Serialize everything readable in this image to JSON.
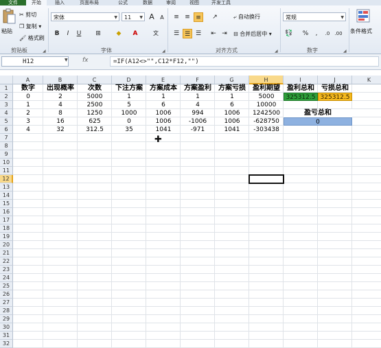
{
  "ribbon": {
    "tabs": [
      "文件",
      "开始",
      "插入",
      "页面布局",
      "公式",
      "数据",
      "审阅",
      "视图",
      "开发工具"
    ],
    "clipboard": {
      "paste": "粘贴",
      "cut": "剪切",
      "copy": "复制",
      "format_painter": "格式刷",
      "group": "剪贴板"
    },
    "font": {
      "name": "宋体",
      "size": "11",
      "bold": "B",
      "italic": "I",
      "underline": "U",
      "grow": "A",
      "shrink": "A",
      "group": "字体"
    },
    "alignment": {
      "wrap": "自动换行",
      "merge": "合并后居中",
      "group": "对齐方式"
    },
    "number": {
      "format": "常规",
      "percent": "%",
      "comma": ",",
      "group": "数字"
    },
    "styles": {
      "conditional": "条件格式"
    }
  },
  "formula_bar": {
    "name_box": "H12",
    "fx": "fx",
    "formula": "=IF(A12<>\"\",C12*F12,\"\")"
  },
  "sheet": {
    "columns": [
      "A",
      "B",
      "C",
      "D",
      "E",
      "F",
      "G",
      "H",
      "I",
      "J",
      "K"
    ],
    "rows": [
      "1",
      "2",
      "3",
      "4",
      "5",
      "6",
      "7",
      "8",
      "9",
      "10",
      "11",
      "12",
      "13",
      "14",
      "15",
      "16",
      "17",
      "18",
      "19",
      "20",
      "21",
      "22",
      "23",
      "24",
      "25",
      "26",
      "27",
      "28",
      "29",
      "30",
      "31",
      "32"
    ],
    "headers": [
      "数字",
      "出现概率",
      "次数",
      "下注方案",
      "方案成本",
      "方案盈利",
      "方案亏损",
      "盈利期望",
      "盈利总和",
      "亏损总和"
    ],
    "data": [
      [
        "0",
        "2",
        "5000",
        "1",
        "1",
        "1",
        "1",
        "5000"
      ],
      [
        "1",
        "4",
        "2500",
        "5",
        "6",
        "4",
        "6",
        "10000"
      ],
      [
        "2",
        "8",
        "1250",
        "1000",
        "1006",
        "994",
        "1006",
        "1242500"
      ],
      [
        "3",
        "16",
        "625",
        "0",
        "1006",
        "-1006",
        "1006",
        "-628750"
      ],
      [
        "4",
        "32",
        "312.5",
        "35",
        "1041",
        "-971",
        "1041",
        "-303438"
      ]
    ],
    "profit_total": "325312.5",
    "loss_total": "325312.5",
    "pl_label": "盈亏总和",
    "pl_value": "0",
    "active_cell": "H12",
    "colors": {
      "profit": "#2e9e3a",
      "loss": "#f5b91e",
      "pl": "#8eb1e0"
    }
  }
}
